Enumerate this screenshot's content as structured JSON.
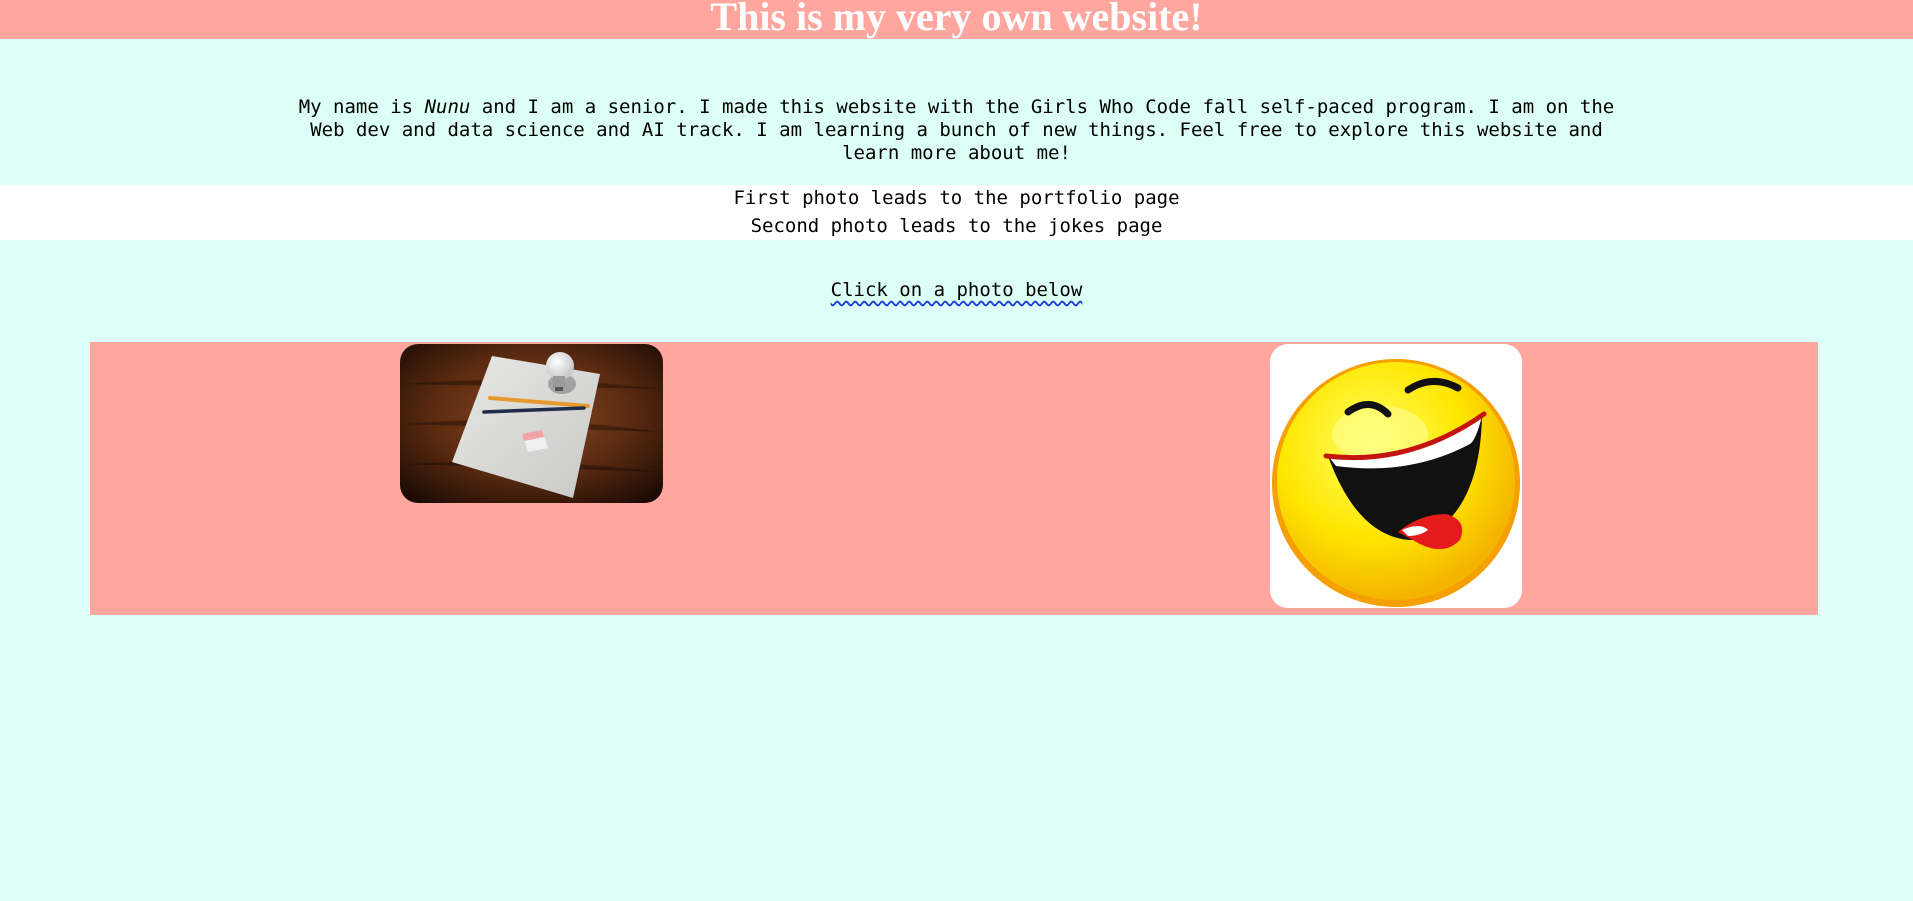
{
  "header": {
    "title": "This is my very own website!"
  },
  "intro": {
    "before_name": "My name is ",
    "name": "Nunu",
    "after_name": " and I am a senior. I made this website with the Girls Who Code fall self-paced program. I am on the Web dev and data science and AI track. I am learning a bunch of new things. Feel free to explore this website and learn more about me!"
  },
  "info": {
    "first": "First photo leads to the portfolio page",
    "second": "Second photo leads to the jokes page"
  },
  "cta": {
    "text": "Click on a photo below"
  },
  "photos": [
    {
      "icon": "lightbulb-paper-pencils-image"
    },
    {
      "icon": "laughing-smiley-image"
    }
  ],
  "colors": {
    "background": "#dcfff6",
    "accent": "#ffa69e",
    "band": "#ffffff"
  }
}
